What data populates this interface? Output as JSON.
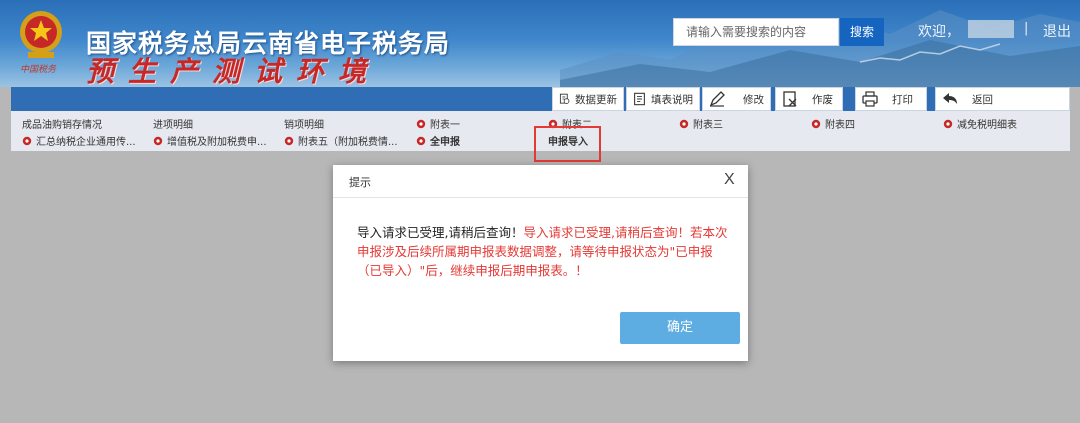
{
  "header": {
    "emblem_sub": "中国税务",
    "title": "国家税务总局云南省电子税务局",
    "subtitle": "预生产测试环境",
    "search_placeholder": "请输入需要搜索的内容",
    "search_label": "搜索",
    "welcome": "欢迎，",
    "separator": "|",
    "logout": "退出"
  },
  "toolbar": {
    "items": [
      {
        "label": "数据更新",
        "icon": "refresh-doc-icon"
      },
      {
        "label": "填表说明",
        "icon": "doc-lines-icon"
      },
      {
        "label": "修改",
        "icon": "pencil-icon"
      },
      {
        "label": "作废",
        "icon": "void-doc-icon"
      },
      {
        "label": "打印",
        "icon": "printer-icon"
      },
      {
        "label": "返回",
        "icon": "back-arrow-icon"
      }
    ]
  },
  "menu": {
    "row1": [
      {
        "label": "成品油购销存情况",
        "gear": false
      },
      {
        "label": "进项明细",
        "gear": false
      },
      {
        "label": "销项明细",
        "gear": false
      },
      {
        "label": "附表一",
        "gear": true
      },
      {
        "label": "附表二",
        "gear": true
      },
      {
        "label": "附表三",
        "gear": true
      },
      {
        "label": "附表四",
        "gear": true
      },
      {
        "label": "减免税明细表",
        "gear": true
      }
    ],
    "row2": [
      {
        "label": "汇总纳税企业通用传...",
        "gear": true
      },
      {
        "label": "增值税及附加税费申...",
        "gear": true
      },
      {
        "label": "附表五（附加税费情...",
        "gear": true
      },
      {
        "label": "全申报",
        "gear": true
      },
      {
        "label": "申报导入",
        "gear": false
      }
    ]
  },
  "modal": {
    "title": "提示",
    "close": "X",
    "msg_black": "导入请求已受理,请稍后查询！",
    "msg_red": "导入请求已受理,请稍后查询！若本次申报涉及后续所属期申报表数据调整，请等待申报状态为\"已申报（已导入）\"后，继续申报后期申报表。！",
    "ok_label": "确定"
  },
  "colors": {
    "header_blue": "#2a6fb7",
    "toolbar_blue": "#2f6eb5",
    "search_button": "#1565c0",
    "ok_button": "#5dade2",
    "alert_red": "#e53935",
    "gear_red": "#c62828"
  }
}
